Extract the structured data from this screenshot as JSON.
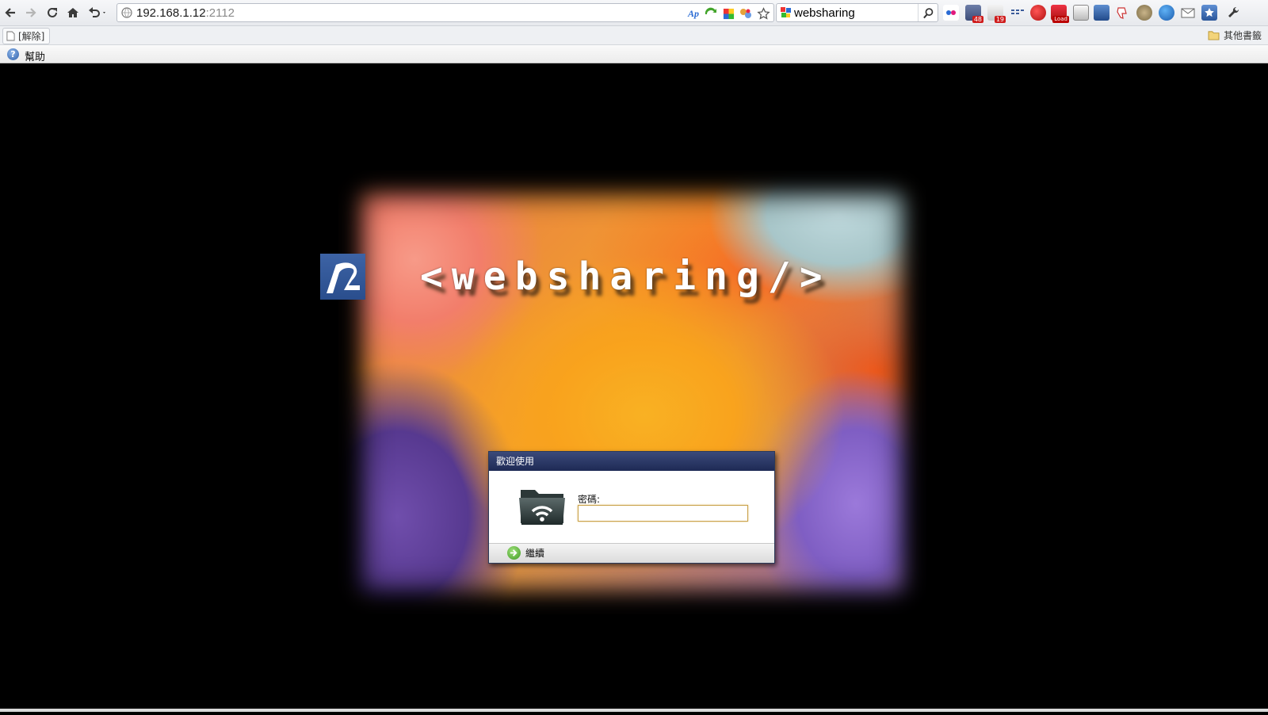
{
  "browser": {
    "url_host": "192.168.1.12",
    "url_port": ":2112",
    "search_value": "websharing",
    "extension_badges": [
      "48",
      "19",
      "Load"
    ]
  },
  "bookmarks": {
    "item_label": "[解除]",
    "other_label": "其他書籤"
  },
  "helpbar": {
    "help_label": "幫助"
  },
  "page": {
    "brand_text": "<websharing/>",
    "dialog": {
      "title": "歡迎使用",
      "password_label": "密碼:",
      "password_value": "",
      "continue_label": "繼續"
    }
  }
}
